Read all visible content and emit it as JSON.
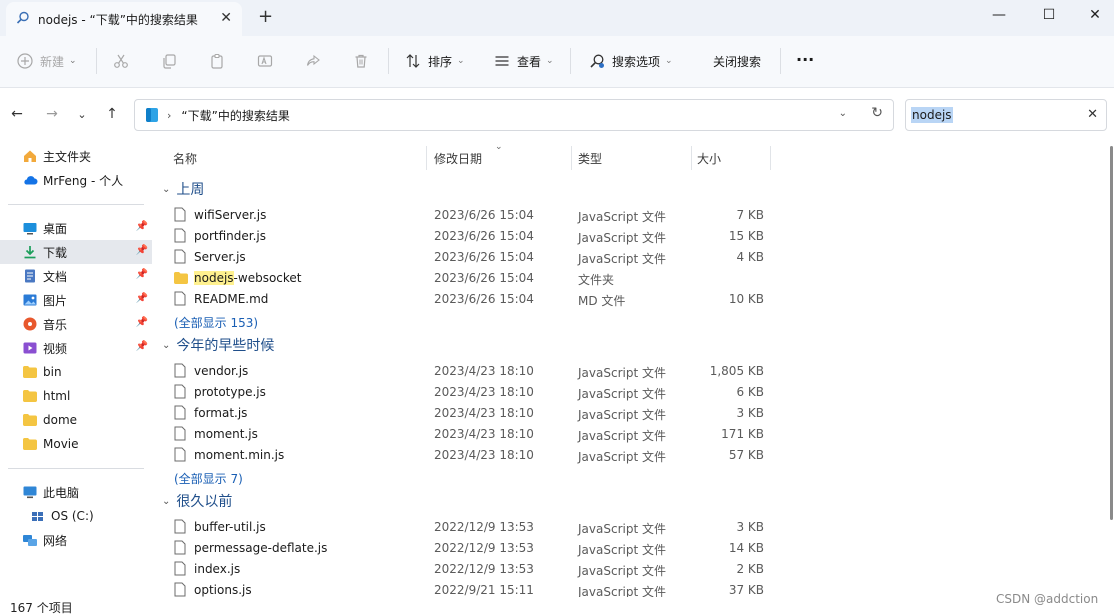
{
  "window": {
    "tab_title": "nodejs - “下载”中的搜索结果",
    "tab_icon": "search-icon",
    "new_tab": "+",
    "controls": {
      "minimize": "—",
      "maximize": "☐",
      "close": "✕"
    }
  },
  "toolbar": {
    "new_label": "新建",
    "sort_label": "排序",
    "view_label": "查看",
    "search_options_label": "搜索选项",
    "close_search_label": "关闭搜索",
    "more_label": "···"
  },
  "address": {
    "crumb": "“下载”中的搜索结果"
  },
  "search": {
    "query": "nodejs"
  },
  "sidebar": {
    "quick": [
      {
        "label": "主文件夹",
        "icon": "home-icon"
      },
      {
        "label": "MrFeng - 个人",
        "icon": "cloud-icon"
      }
    ],
    "pinned": [
      {
        "label": "桌面",
        "icon": "desktop-icon"
      },
      {
        "label": "下载",
        "icon": "download-icon"
      },
      {
        "label": "文档",
        "icon": "document-icon"
      },
      {
        "label": "图片",
        "icon": "image-icon"
      },
      {
        "label": "音乐",
        "icon": "music-icon"
      },
      {
        "label": "视频",
        "icon": "video-icon"
      }
    ],
    "folders": [
      {
        "label": "bin"
      },
      {
        "label": "html"
      },
      {
        "label": "dome"
      },
      {
        "label": "Movie"
      }
    ],
    "devices": [
      {
        "label": "此电脑",
        "icon": "computer-icon"
      },
      {
        "label": "OS (C:)",
        "icon": "drive-icon"
      },
      {
        "label": "网络",
        "icon": "network-icon"
      }
    ]
  },
  "columns": {
    "name": "名称",
    "date": "修改日期",
    "type": "类型",
    "size": "大小"
  },
  "groups": [
    {
      "title": "上周",
      "files": [
        {
          "name": "wifiServer.js",
          "date": "2023/6/26 15:04",
          "type": "JavaScript 文件",
          "size": "7 KB",
          "kind": "file"
        },
        {
          "name": "portfinder.js",
          "date": "2023/6/26 15:04",
          "type": "JavaScript 文件",
          "size": "15 KB",
          "kind": "file"
        },
        {
          "name": "Server.js",
          "date": "2023/6/26 15:04",
          "type": "JavaScript 文件",
          "size": "4 KB",
          "kind": "file"
        },
        {
          "name_hl": "nodejs",
          "name_rest": "-websocket",
          "date": "2023/6/26 15:04",
          "type": "文件夹",
          "size": "",
          "kind": "folder"
        },
        {
          "name": "README.md",
          "date": "2023/6/26 15:04",
          "type": "MD 文件",
          "size": "10 KB",
          "kind": "file"
        }
      ],
      "show_all": "(全部显示 153)"
    },
    {
      "title": "今年的早些时候",
      "files": [
        {
          "name": "vendor.js",
          "date": "2023/4/23 18:10",
          "type": "JavaScript 文件",
          "size": "1,805 KB",
          "kind": "file"
        },
        {
          "name": "prototype.js",
          "date": "2023/4/23 18:10",
          "type": "JavaScript 文件",
          "size": "6 KB",
          "kind": "file"
        },
        {
          "name": "format.js",
          "date": "2023/4/23 18:10",
          "type": "JavaScript 文件",
          "size": "3 KB",
          "kind": "file"
        },
        {
          "name": "moment.js",
          "date": "2023/4/23 18:10",
          "type": "JavaScript 文件",
          "size": "171 KB",
          "kind": "file"
        },
        {
          "name": "moment.min.js",
          "date": "2023/4/23 18:10",
          "type": "JavaScript 文件",
          "size": "57 KB",
          "kind": "file"
        }
      ],
      "show_all": "(全部显示 7)"
    },
    {
      "title": "很久以前",
      "files": [
        {
          "name": "buffer-util.js",
          "date": "2022/12/9 13:53",
          "type": "JavaScript 文件",
          "size": "3 KB",
          "kind": "file"
        },
        {
          "name": "permessage-deflate.js",
          "date": "2022/12/9 13:53",
          "type": "JavaScript 文件",
          "size": "14 KB",
          "kind": "file"
        },
        {
          "name": "index.js",
          "date": "2022/12/9 13:53",
          "type": "JavaScript 文件",
          "size": "2 KB",
          "kind": "file"
        },
        {
          "name": "options.js",
          "date": "2022/9/21 15:11",
          "type": "JavaScript 文件",
          "size": "37 KB",
          "kind": "file"
        }
      ]
    }
  ],
  "status": {
    "item_count": "167 个项目"
  },
  "watermark": "CSDN @addction",
  "colors": {
    "accent": "#1a5fb4",
    "group_header": "#1f4e8a",
    "highlight": "#fff18f",
    "search_selection": "#b9d5f5",
    "folder": "#f4c542"
  }
}
